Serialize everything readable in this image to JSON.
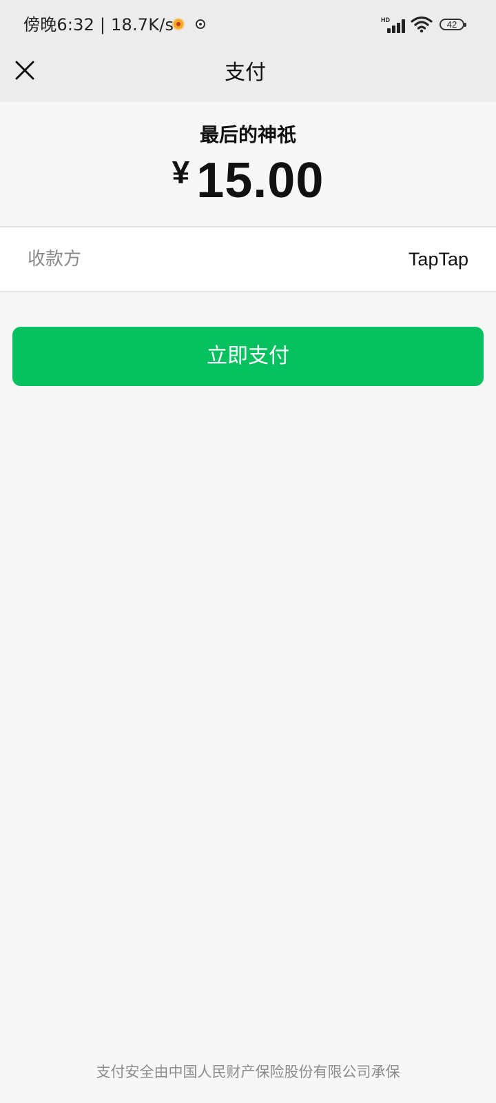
{
  "status_bar": {
    "time_text": "傍晚6:32 | 18.7K/s",
    "network_label": "HD",
    "battery_level": "42",
    "icons": [
      "notification-app-icon",
      "notification-dot-icon",
      "signal-icon",
      "wifi-icon",
      "battery-icon"
    ]
  },
  "nav": {
    "title": "支付",
    "close_icon": "close-icon"
  },
  "order": {
    "product_name": "最后的神祇",
    "currency_symbol": "¥",
    "amount": "15.00"
  },
  "payee": {
    "label": "收款方",
    "value": "TapTap"
  },
  "actions": {
    "pay_label": "立即支付",
    "pay_color": "#07c160"
  },
  "footer": {
    "note": "支付安全由中国人民财产保险股份有限公司承保"
  }
}
